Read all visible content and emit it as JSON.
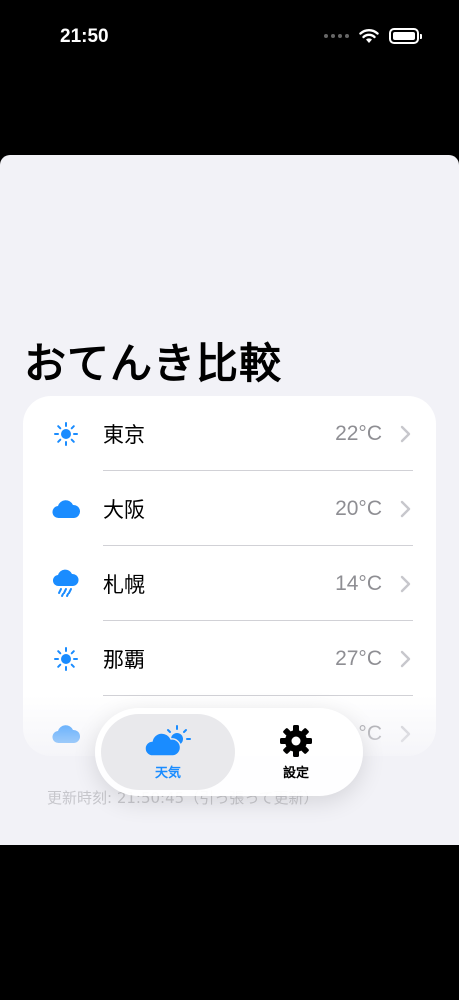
{
  "status_bar": {
    "time": "21:50"
  },
  "page": {
    "title": "おてんき比較"
  },
  "cities": [
    {
      "name": "東京",
      "temp": "22°C",
      "icon": "sun-icon"
    },
    {
      "name": "大阪",
      "temp": "20°C",
      "icon": "cloud-icon"
    },
    {
      "name": "札幌",
      "temp": "14°C",
      "icon": "rain-cloud-icon"
    },
    {
      "name": "那覇",
      "temp": "27°C",
      "icon": "sun-icon"
    },
    {
      "name": "",
      "temp": "°C",
      "icon": "cloud-icon"
    }
  ],
  "updated_text": "更新時刻: 21:50:45（引っ張って更新）",
  "tabs": [
    {
      "label": "天気",
      "icon": "cloud-sun-icon",
      "selected": true
    },
    {
      "label": "設定",
      "icon": "gear-icon",
      "selected": false
    }
  ],
  "colors": {
    "accent": "#1a8cff",
    "background": "#f2f2f7",
    "secondary_text": "#8e8e93"
  }
}
